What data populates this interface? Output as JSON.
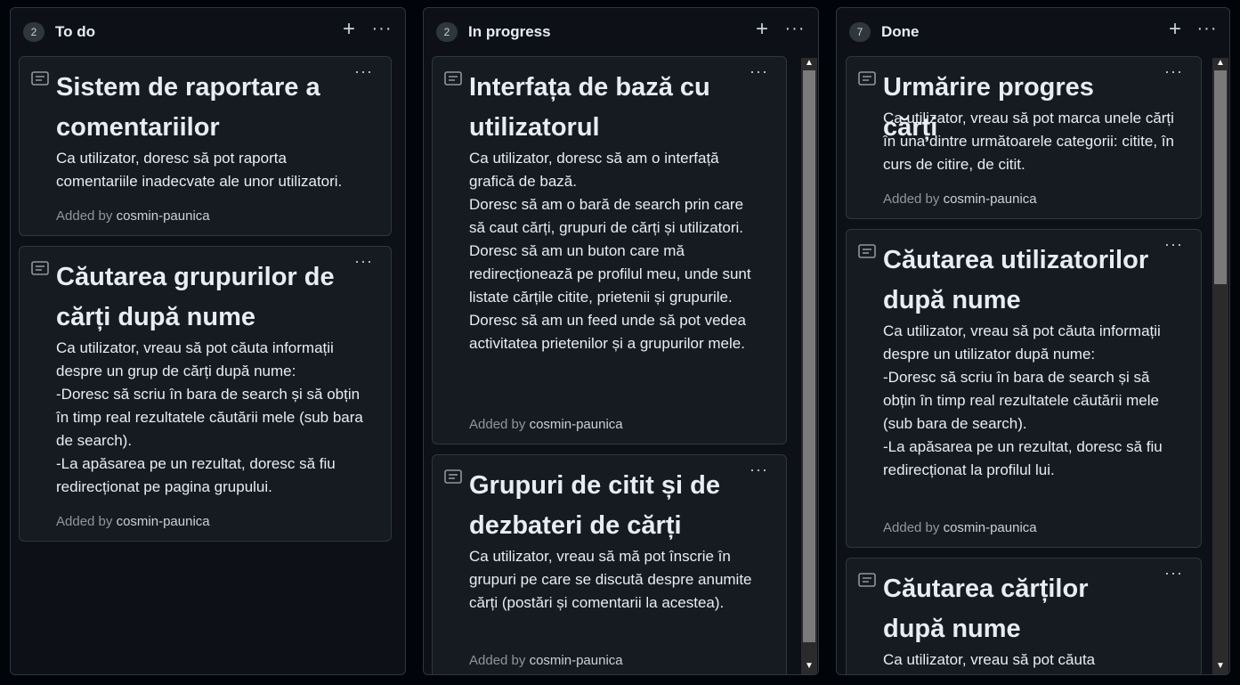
{
  "columns": [
    {
      "count": "2",
      "title": "To do",
      "add_label": "+",
      "more_label": "···",
      "cards": [
        {
          "title": "Sistem de raportare a comentariilor",
          "body": "Ca utilizator, doresc să pot raporta comentariile inadecvate ale unor utilizatori.",
          "added_by_label": "Added by",
          "author": "cosmin-paunica"
        },
        {
          "title": "Căutarea grupurilor de cărți după nume",
          "body": "Ca utilizator, vreau să pot căuta informații despre un grup de cărți după nume:\n-Doresc să scriu în bara de search și să obțin în timp real rezultatele căutării mele (sub bara de search).\n-La apăsarea pe un rezultat, doresc să fiu redirecționat pe pagina grupului.",
          "added_by_label": "Added by",
          "author": "cosmin-paunica"
        }
      ]
    },
    {
      "count": "2",
      "title": "In progress",
      "add_label": "+",
      "more_label": "···",
      "cards": [
        {
          "title": "Interfața de bază cu utilizatorul",
          "body": "Ca utilizator, doresc să am o interfață grafică de bază.\nDoresc să am o bară de search prin care să caut cărți, grupuri de cărți și utilizatori.\nDoresc să am un buton care mă redirecționează pe profilul meu, unde sunt listate cărțile citite, prietenii și grupurile.\nDoresc să am un feed unde să pot vedea activitatea prietenilor și a grupurilor mele.",
          "added_by_label": "Added by",
          "author": "cosmin-paunica"
        },
        {
          "title": "Grupuri de citit și de dezbateri de cărți",
          "body": "Ca utilizator, vreau să mă pot înscrie în grupuri pe care se discută despre anumite cărți (postări și comentarii la acestea).",
          "added_by_label": "Added by",
          "author": "cosmin-paunica"
        }
      ]
    },
    {
      "count": "7",
      "title": "Done",
      "add_label": "+",
      "more_label": "···",
      "cards": [
        {
          "title": "Urmărire progres cărți",
          "body": "Ca utilizator, vreau să pot marca unele cărți în una dintre următoarele categorii: citite, în curs de citire, de citit.",
          "added_by_label": "Added by",
          "author": "cosmin-paunica"
        },
        {
          "title": "Căutarea utilizatorilor după nume",
          "body": "Ca utilizator, vreau să pot căuta informații despre un utilizator după nume:\n-Doresc să scriu în bara de search și să obțin în timp real rezultatele căutării mele (sub bara de search).\n-La apăsarea pe un rezultat, doresc să fiu redirecționat la profilul lui.",
          "added_by_label": "Added by",
          "author": "cosmin-paunica"
        },
        {
          "title": "Căutarea cărților după nume",
          "body": "Ca utilizator, vreau să pot căuta",
          "added_by_label": "",
          "author": ""
        }
      ]
    }
  ],
  "card_more_label": "···",
  "scroll_up": "▲",
  "scroll_down": "▼",
  "icons": {
    "note": "note-icon",
    "add": "plus-icon",
    "more": "kebab-icon"
  },
  "colors": {
    "background": "#010409",
    "column": "#0d1117",
    "card": "#161b22",
    "border": "#30363d",
    "muted_text": "#8d96a0"
  }
}
